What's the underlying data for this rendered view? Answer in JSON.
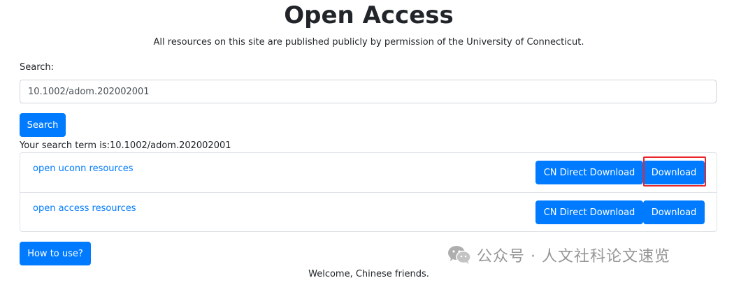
{
  "header": {
    "title": "Open Access",
    "subtitle": "All resources on this site are published publicly by permission of the University of Connecticut."
  },
  "search": {
    "label": "Search:",
    "value": "10.1002/adom.202002001",
    "button_label": "Search",
    "term_text": "Your search term is:10.1002/adom.202002001"
  },
  "results": [
    {
      "link_label": "open uconn resources",
      "cn_button_label": "CN Direct Download",
      "download_label": "Download"
    },
    {
      "link_label": "open access resources",
      "cn_button_label": "CN Direct Download",
      "download_label": "Download"
    }
  ],
  "footer": {
    "howto_label": "How to use?",
    "welcome": "Welcome, Chinese friends."
  },
  "watermark": {
    "text": "公众号 · 人文社科论文速览",
    "icon": "wechat-icon"
  },
  "colors": {
    "primary": "#007bff",
    "highlight": "#e8262b"
  }
}
